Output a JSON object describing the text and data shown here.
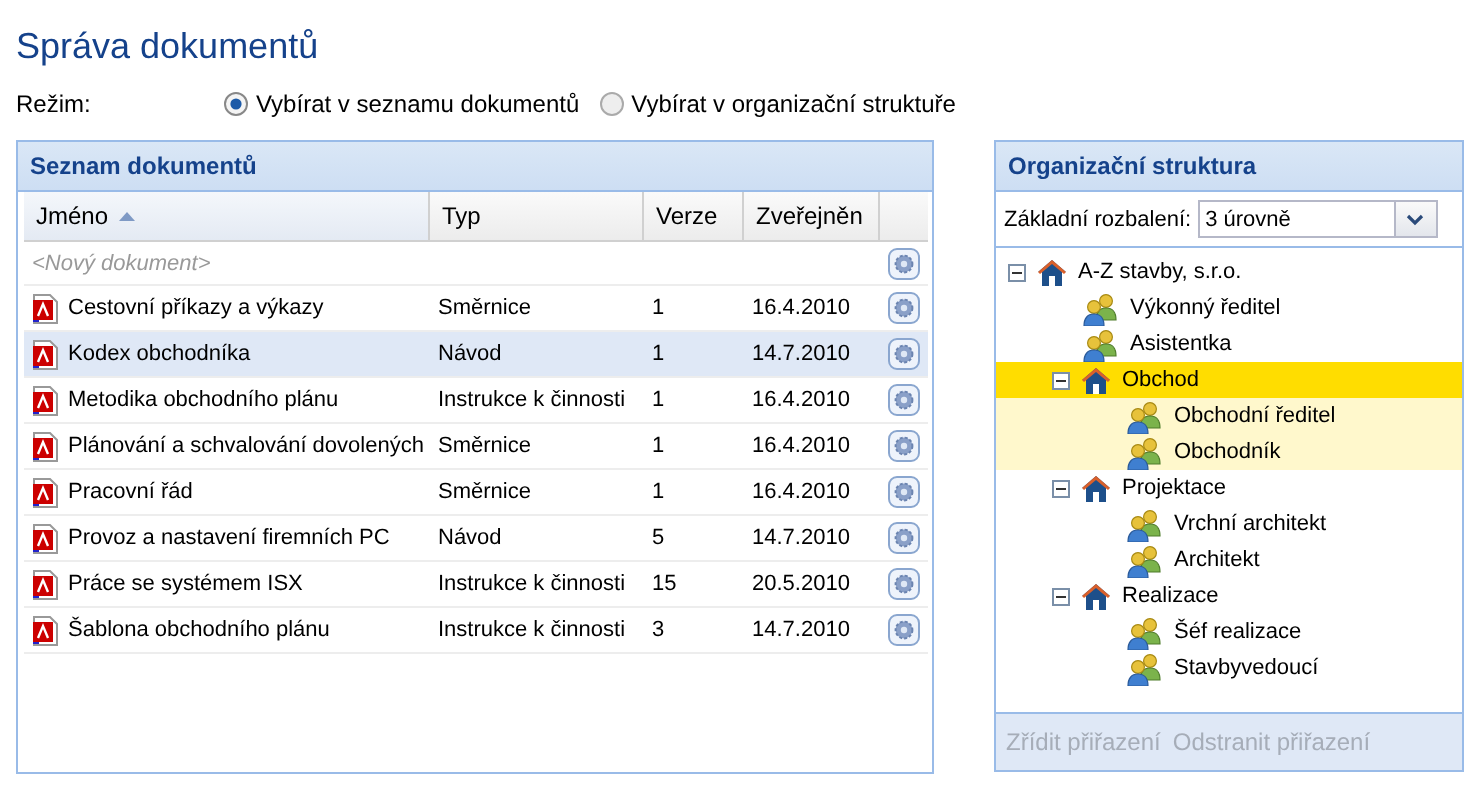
{
  "title": "Správa dokumentů",
  "mode": {
    "label": "Režim:",
    "options": [
      {
        "label": "Vybírat v seznamu dokumentů",
        "selected": true
      },
      {
        "label": "Vybírat v organizační struktuře",
        "selected": false
      }
    ]
  },
  "documents": {
    "title": "Seznam dokumentů",
    "columns": [
      {
        "label": "Jméno",
        "sort_ascending": true
      },
      {
        "label": "Typ",
        "sort_ascending": false
      },
      {
        "label": "Verze",
        "sort_ascending": false
      },
      {
        "label": "Zveřejněn",
        "sort_ascending": false
      }
    ],
    "new_row": "<Nový dokument>",
    "rows": [
      {
        "name": "Cestovní příkazy a výkazy",
        "type": "Směrnice",
        "version": "1",
        "published": "16.4.2010",
        "selected": false
      },
      {
        "name": "Kodex obchodníka",
        "type": "Návod",
        "version": "1",
        "published": "14.7.2010",
        "selected": true
      },
      {
        "name": "Metodika obchodního plánu",
        "type": "Instrukce k činnosti",
        "version": "1",
        "published": "16.4.2010",
        "selected": false
      },
      {
        "name": "Plánování a schvalování dovolených",
        "type": "Směrnice",
        "version": "1",
        "published": "16.4.2010",
        "selected": false
      },
      {
        "name": "Pracovní řád",
        "type": "Směrnice",
        "version": "1",
        "published": "16.4.2010",
        "selected": false
      },
      {
        "name": "Provoz a nastavení firemních PC",
        "type": "Návod",
        "version": "5",
        "published": "14.7.2010",
        "selected": false
      },
      {
        "name": "Práce se systémem ISX",
        "type": "Instrukce k činnosti",
        "version": "15",
        "published": "20.5.2010",
        "selected": false
      },
      {
        "name": "Šablona obchodního plánu",
        "type": "Instrukce k činnosti",
        "version": "3",
        "published": "14.7.2010",
        "selected": false
      }
    ]
  },
  "org": {
    "title": "Organizační struktura",
    "expand_label": "Základní rozbalení:",
    "expand_value": "3 úrovně",
    "tree": [
      {
        "label": "A-Z stavby, s.r.o.",
        "kind": "unit",
        "expanded": true,
        "selected": false,
        "children": [
          {
            "label": "Výkonný ředitel",
            "kind": "role",
            "selected": false
          },
          {
            "label": "Asistentka",
            "kind": "role",
            "selected": false
          },
          {
            "label": "Obchod",
            "kind": "unit",
            "expanded": true,
            "selected": true,
            "children": [
              {
                "label": "Obchodní ředitel",
                "kind": "role",
                "selected": false
              },
              {
                "label": "Obchodník",
                "kind": "role",
                "selected": false
              }
            ]
          },
          {
            "label": "Projektace",
            "kind": "unit",
            "expanded": true,
            "selected": false,
            "children": [
              {
                "label": "Vrchní architekt",
                "kind": "role",
                "selected": false
              },
              {
                "label": "Architekt",
                "kind": "role",
                "selected": false
              }
            ]
          },
          {
            "label": "Realizace",
            "kind": "unit",
            "expanded": true,
            "selected": false,
            "children": [
              {
                "label": "Šéf realizace",
                "kind": "role",
                "selected": false
              },
              {
                "label": "Stavbyvedoucí",
                "kind": "role",
                "selected": false
              }
            ]
          }
        ]
      }
    ],
    "buttons": [
      {
        "label": "Zřídit přiřazení",
        "disabled": true
      },
      {
        "label": "Odstranit přiřazení",
        "disabled": true
      }
    ]
  }
}
